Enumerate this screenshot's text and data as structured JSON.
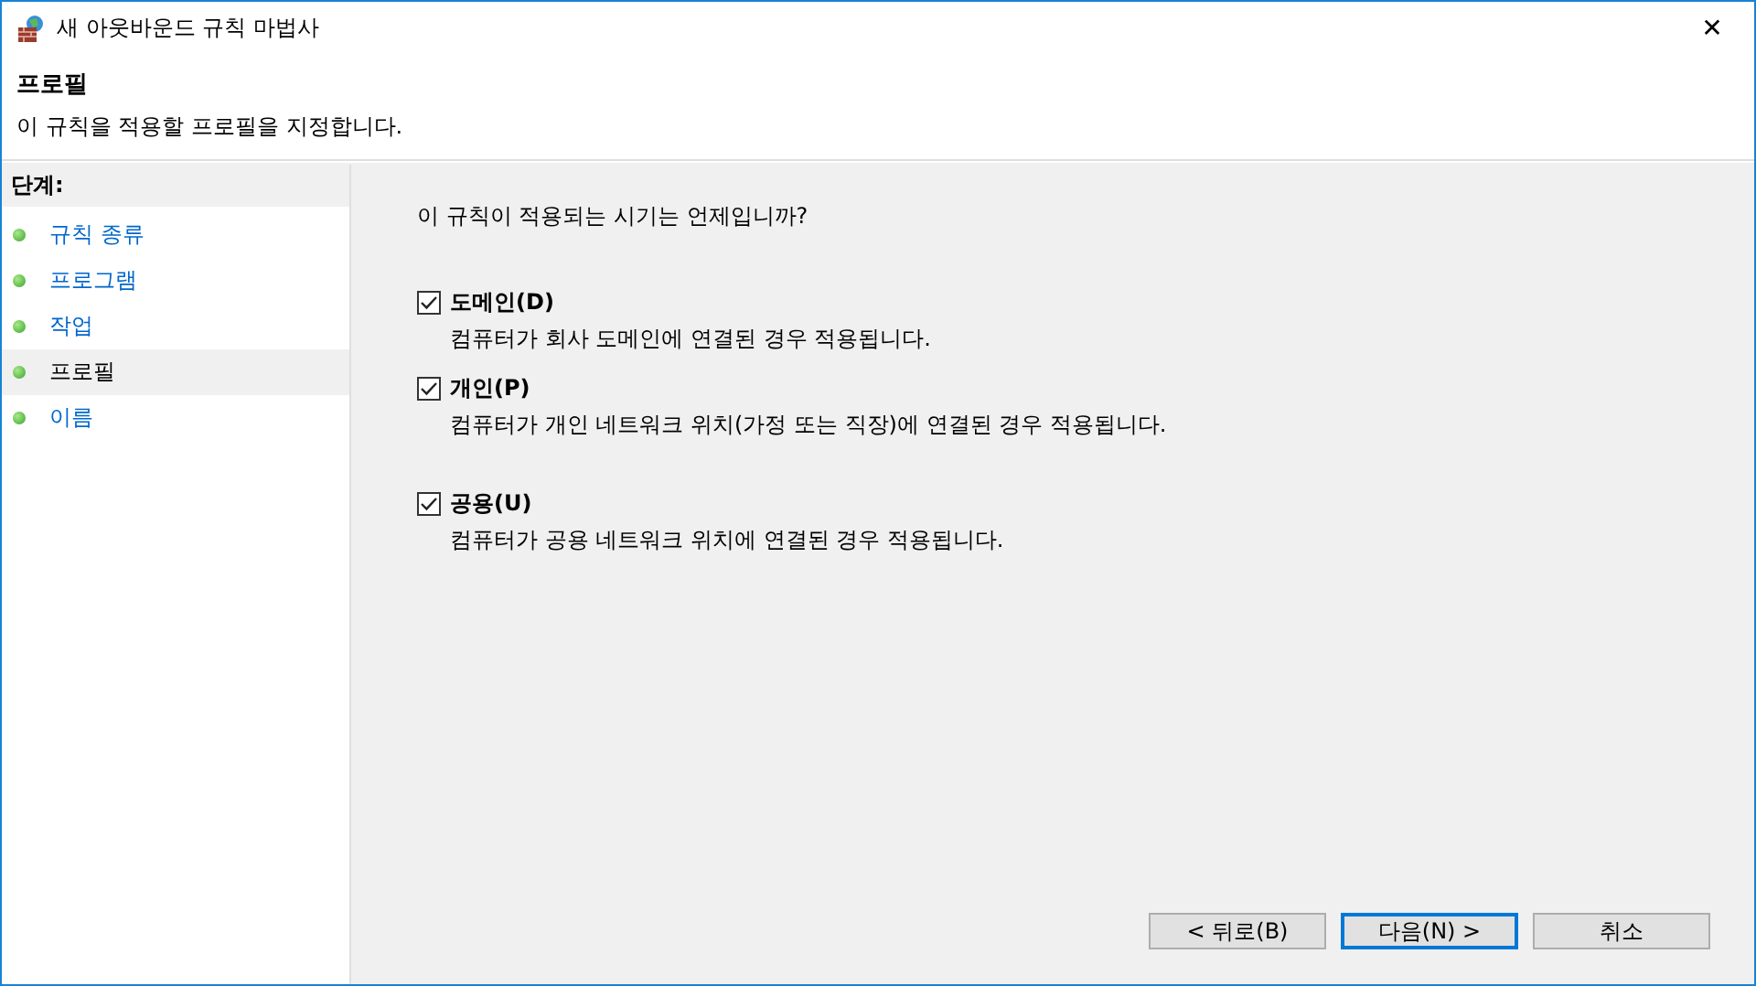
{
  "window": {
    "title": "새 아웃바운드 규칙 마법사",
    "close": "✕"
  },
  "header": {
    "title": "프로필",
    "subtitle": "이 규칙을 적용할 프로필을 지정합니다."
  },
  "steps": {
    "heading": "단계:",
    "items": [
      {
        "label": "규칙 종류",
        "selected": false
      },
      {
        "label": "프로그램",
        "selected": false
      },
      {
        "label": "작업",
        "selected": false
      },
      {
        "label": "프로필",
        "selected": true
      },
      {
        "label": "이름",
        "selected": false
      }
    ]
  },
  "question": "이 규칙이 적용되는 시기는 언제입니까?",
  "options": [
    {
      "label": "도메인(D)",
      "description": "컴퓨터가 회사 도메인에 연결된 경우 적용됩니다.",
      "checked": true
    },
    {
      "label": "개인(P)",
      "description": "컴퓨터가 개인 네트워크 위치(가정 또는 직장)에 연결된 경우 적용됩니다.",
      "checked": true
    },
    {
      "label": "공용(U)",
      "description": "컴퓨터가 공용 네트워크 위치에 연결된 경우 적용됩니다.",
      "checked": true
    }
  ],
  "buttons": [
    {
      "label": "< 뒤로(B)",
      "default": false
    },
    {
      "label": "다음(N) >",
      "default": true
    },
    {
      "label": "취소",
      "default": false
    }
  ]
}
